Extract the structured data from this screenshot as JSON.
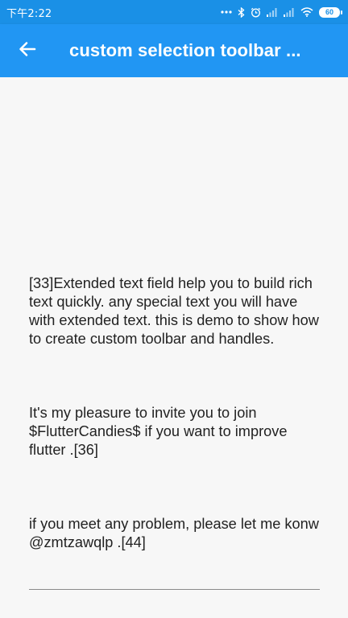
{
  "status_bar": {
    "time": "下午2:22",
    "battery": "60",
    "icons": [
      "more-dots-icon",
      "bluetooth-icon",
      "alarm-icon",
      "signal-icon",
      "signal-icon-2",
      "wifi-icon",
      "battery-icon"
    ]
  },
  "app_bar": {
    "title": "custom selection toolbar ...",
    "back_icon": "arrow-back-icon",
    "color": "#2196f3"
  },
  "text_field": {
    "paragraphs": [
      "[33]Extended text field help you to build rich text quickly. any special text you will have with extended text. this is demo to show how to create custom toolbar and handles.",
      "It's my pleasure to invite you to join $FlutterCandies$ if you want to improve flutter .[36]",
      "if you meet any problem, please let me konw @zmtzawqlp .[44]"
    ]
  }
}
